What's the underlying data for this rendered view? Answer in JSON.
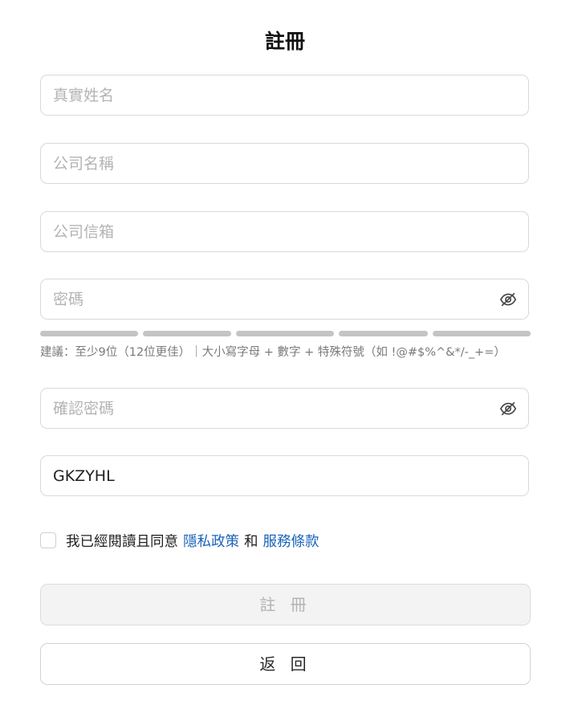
{
  "title": "註冊",
  "fields": {
    "real_name": {
      "placeholder": "真實姓名",
      "value": ""
    },
    "company_name": {
      "placeholder": "公司名稱",
      "value": ""
    },
    "company_email": {
      "placeholder": "公司信箱",
      "value": ""
    },
    "password": {
      "placeholder": "密碼",
      "value": "",
      "toggle_icon": "eye-off-icon"
    },
    "confirm_password": {
      "placeholder": "確認密碼",
      "value": "",
      "toggle_icon": "eye-off-icon"
    },
    "captcha": {
      "placeholder": "",
      "value": "GKZYHL"
    }
  },
  "password_strength": {
    "segments": 5,
    "filled": 0,
    "segment_color": "#c4c4c4",
    "hint": "建議：至少9位（12位更佳）｜大小寫字母 + 數字 + 特殊符號（如 !@#$%^&*/-_+=）"
  },
  "agreement": {
    "checked": false,
    "text_before": "我已經閱讀且同意",
    "privacy_link": "隱私政策",
    "conjunction": "和",
    "terms_link": "服務條款",
    "link_color": "#1a63b8"
  },
  "buttons": {
    "register": "註 冊",
    "back": "返 回"
  }
}
